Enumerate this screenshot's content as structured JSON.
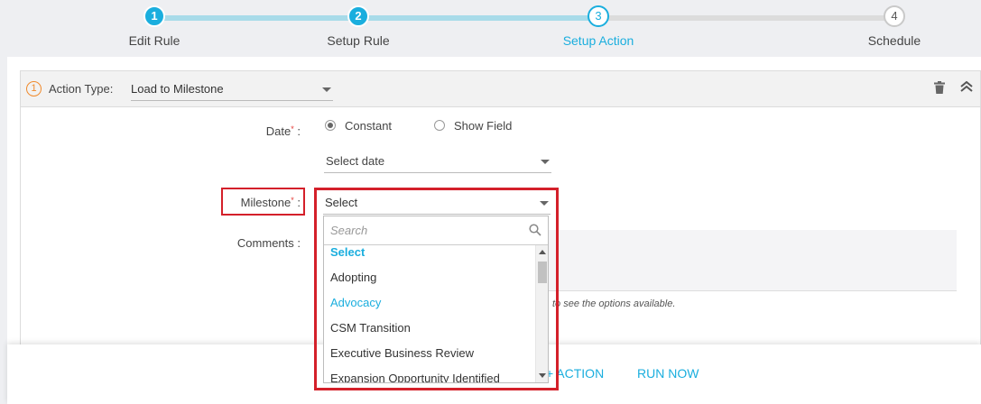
{
  "stepper": {
    "steps": [
      {
        "number": "1",
        "label": "Edit Rule",
        "state": "done"
      },
      {
        "number": "2",
        "label": "Setup Rule",
        "state": "done"
      },
      {
        "number": "3",
        "label": "Setup Action",
        "state": "active"
      },
      {
        "number": "4",
        "label": "Schedule",
        "state": "pending"
      }
    ]
  },
  "action": {
    "index": "1",
    "type_label": "Action Type:",
    "type_value": "Load to Milestone"
  },
  "form": {
    "date_label": "Date",
    "date_options": [
      "Constant",
      "Show Field"
    ],
    "date_placeholder": "Select date",
    "milestone_label": "Milestone",
    "milestone_value": "Select",
    "comments_label": "Comments :",
    "hint_text": "to see the options available."
  },
  "dropdown": {
    "search_placeholder": "Search",
    "items": [
      "Select",
      "Adopting",
      "Advocacy",
      "CSM Transition",
      "Executive Business Review",
      "Expansion Opportunity Identified"
    ]
  },
  "footer": {
    "add_action": "+ ACTION",
    "run_now": "RUN NOW"
  },
  "colors": {
    "accent": "#1aaede",
    "highlight": "#d4202a",
    "required": "#e53935"
  }
}
